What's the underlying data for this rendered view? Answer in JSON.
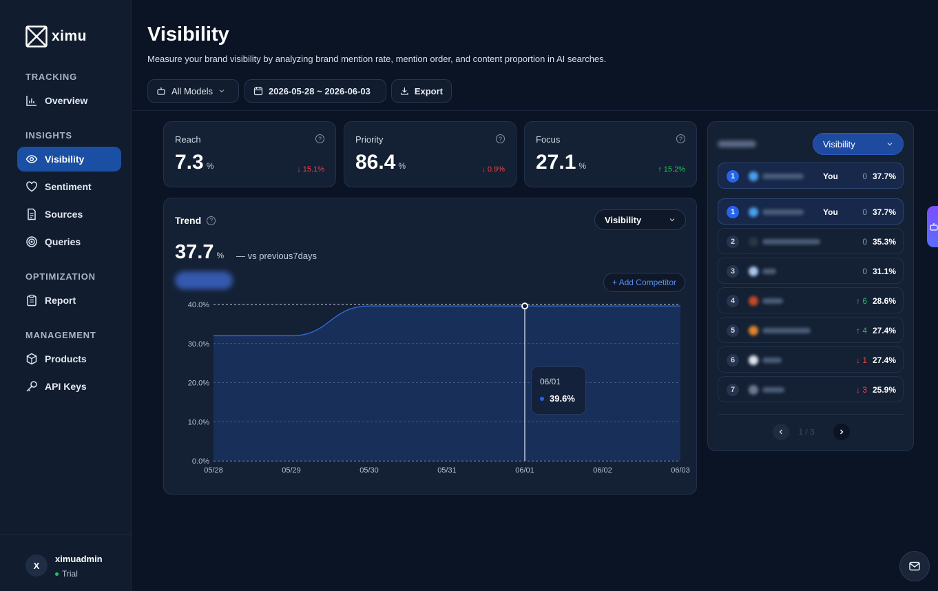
{
  "app": {
    "logo_text": "ximu"
  },
  "sidebar": {
    "sections": [
      {
        "label": "TRACKING",
        "items": [
          {
            "label": "Overview",
            "icon": "bar-chart-icon"
          }
        ]
      },
      {
        "label": "INSIGHTS",
        "items": [
          {
            "label": "Visibility",
            "icon": "eye-icon",
            "active": true
          },
          {
            "label": "Sentiment",
            "icon": "heart-icon"
          },
          {
            "label": "Sources",
            "icon": "document-icon"
          },
          {
            "label": "Queries",
            "icon": "target-icon"
          }
        ]
      },
      {
        "label": "OPTIMIZATION",
        "items": [
          {
            "label": "Report",
            "icon": "clipboard-icon"
          }
        ]
      },
      {
        "label": "MANAGEMENT",
        "items": [
          {
            "label": "Products",
            "icon": "box-icon"
          },
          {
            "label": "API Keys",
            "icon": "key-icon"
          }
        ]
      }
    ],
    "user": {
      "initial": "X",
      "name": "ximuadmin",
      "plan": "Trial"
    }
  },
  "header": {
    "title": "Visibility",
    "subtitle": "Measure your brand visibility by analyzing brand mention rate, mention order, and content proportion in AI searches.",
    "model_filter": "All Models",
    "date_range": "2026-05-28 ~ 2026-06-03",
    "export_label": "Export"
  },
  "metrics": [
    {
      "label": "Reach",
      "value": "7.3",
      "unit": "%",
      "change": "↓ 15.1%",
      "direction": "down"
    },
    {
      "label": "Priority",
      "value": "86.4",
      "unit": "%",
      "change": "↓ 0.9%",
      "direction": "down"
    },
    {
      "label": "Focus",
      "value": "27.1",
      "unit": "%",
      "change": "↑ 15.2%",
      "direction": "up"
    }
  ],
  "trend": {
    "title": "Trend",
    "metric_select": "Visibility",
    "value": "37.7",
    "unit": "%",
    "comparison": "— vs previous7days",
    "add_competitor_label": "+ Add Competitor",
    "tooltip": {
      "date": "06/01",
      "value": "39.6%"
    }
  },
  "chart_data": {
    "type": "area",
    "x": [
      "05/28",
      "05/29",
      "05/30",
      "05/31",
      "06/01",
      "06/02",
      "06/03"
    ],
    "series": [
      {
        "values": [
          32,
          32,
          39.6,
          39.6,
          39.6,
          39.6,
          39.6
        ]
      }
    ],
    "ylim": [
      0,
      40
    ],
    "yticks": [
      "0.0%",
      "10.0%",
      "20.0%",
      "30.0%",
      "40.0%"
    ],
    "grid": true,
    "highlight_index": 4,
    "colors": {
      "fill": "#1a3468",
      "line": "#2f66d0"
    }
  },
  "ranking": {
    "metric_select": "Visibility",
    "you_label": "You",
    "rows": [
      {
        "rank": "1",
        "you": true,
        "delta": "0",
        "delta_dir": "none",
        "value": "37.7%",
        "icon_color": "#4a9fe6",
        "name_w": 60
      },
      {
        "rank": "1",
        "you": true,
        "delta": "0",
        "delta_dir": "none",
        "value": "37.7%",
        "icon_color": "#4a9fe6",
        "name_w": 60
      },
      {
        "rank": "2",
        "you": false,
        "delta": "0",
        "delta_dir": "none",
        "value": "35.3%",
        "icon_color": "#2a3648",
        "name_w": 84
      },
      {
        "rank": "3",
        "you": false,
        "delta": "0",
        "delta_dir": "none",
        "value": "31.1%",
        "icon_color": "#a9c9ee",
        "name_w": 20
      },
      {
        "rank": "4",
        "you": false,
        "delta": "↑ 6",
        "delta_dir": "up",
        "value": "28.6%",
        "icon_color": "#c24b2a",
        "name_w": 30
      },
      {
        "rank": "5",
        "you": false,
        "delta": "↑ 4",
        "delta_dir": "up",
        "value": "27.4%",
        "icon_color": "#e0862c",
        "name_w": 70
      },
      {
        "rank": "6",
        "you": false,
        "delta": "↓ 1",
        "delta_dir": "down",
        "value": "27.4%",
        "icon_color": "#dfe5ee",
        "name_w": 28
      },
      {
        "rank": "7",
        "you": false,
        "delta": "↓ 3",
        "delta_dir": "down",
        "value": "25.9%",
        "icon_color": "#6e7c92",
        "name_w": 32
      }
    ],
    "page": "1 / 3"
  }
}
